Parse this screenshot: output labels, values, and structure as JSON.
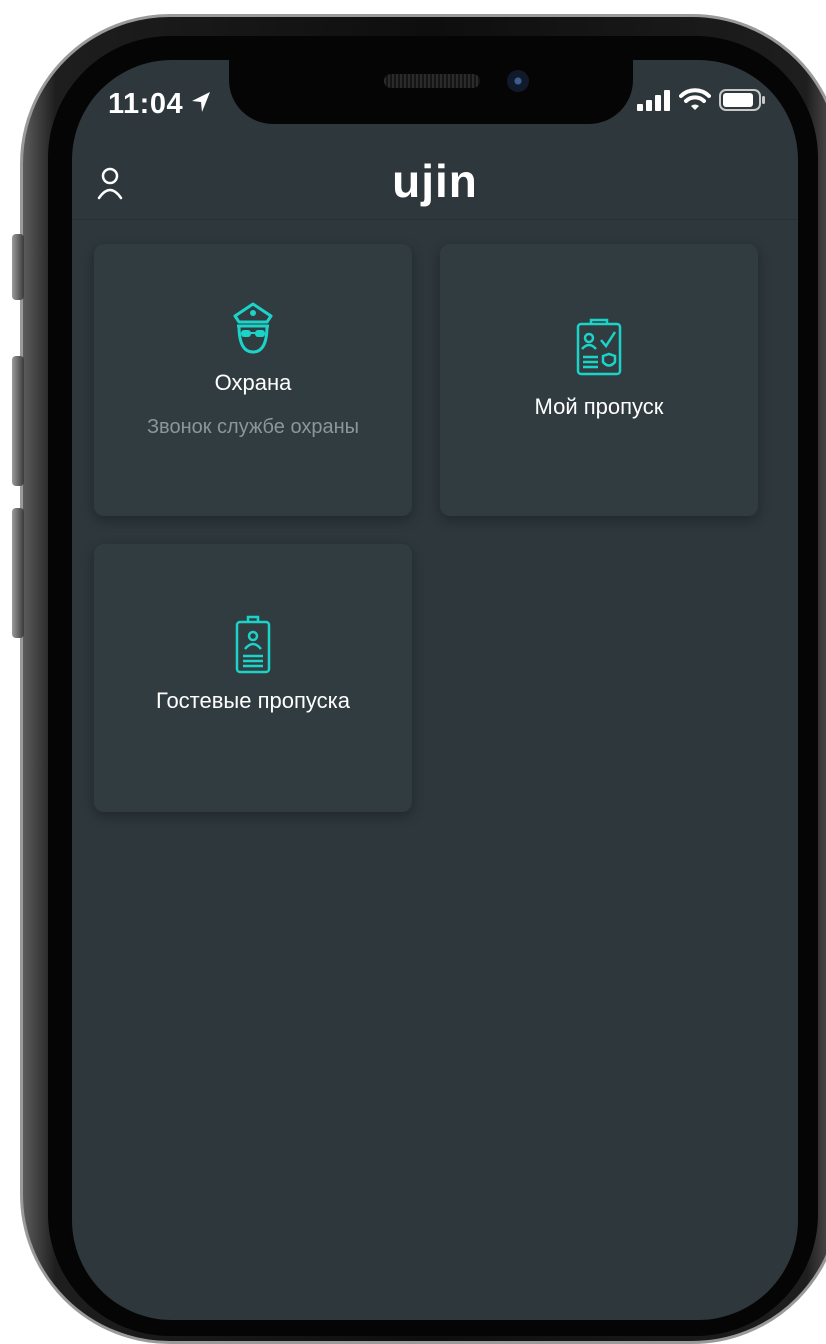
{
  "status_bar": {
    "time": "11:04"
  },
  "header": {
    "logo": "ujin"
  },
  "tiles": [
    {
      "title": "Охрана",
      "subtitle": "Звонок службе охраны",
      "icon": "security-guard-icon"
    },
    {
      "title": "Мой пропуск",
      "icon": "my-pass-icon"
    },
    {
      "title": "Гостевые пропуска",
      "icon": "guest-pass-icon"
    }
  ],
  "colors": {
    "background": "#2d373c",
    "card": "#313c41",
    "accent": "#1bd3c8",
    "text": "#ffffff",
    "subtext": "#8b969b"
  }
}
